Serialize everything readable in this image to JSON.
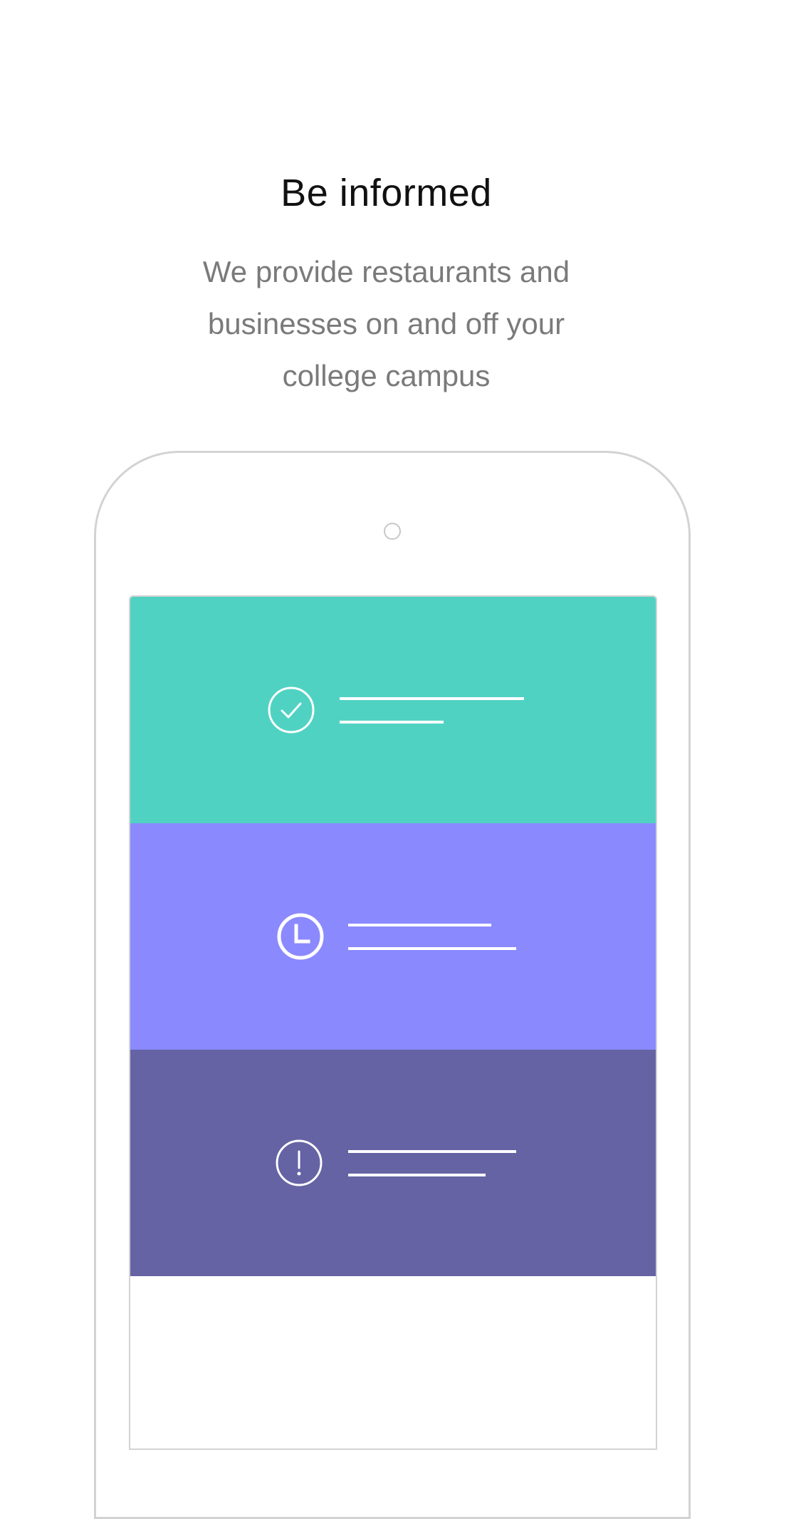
{
  "onboarding": {
    "title": "Be informed",
    "description_lines": [
      "We provide restaurants and",
      "businesses on and off your",
      "college campus"
    ]
  },
  "phone_mockup": {
    "cards": [
      {
        "icon": "check-circle-icon",
        "color": "#50D2C3"
      },
      {
        "icon": "clock-icon",
        "color": "#8B89FE"
      },
      {
        "icon": "alert-circle-icon",
        "color": "#6563A4"
      }
    ]
  }
}
